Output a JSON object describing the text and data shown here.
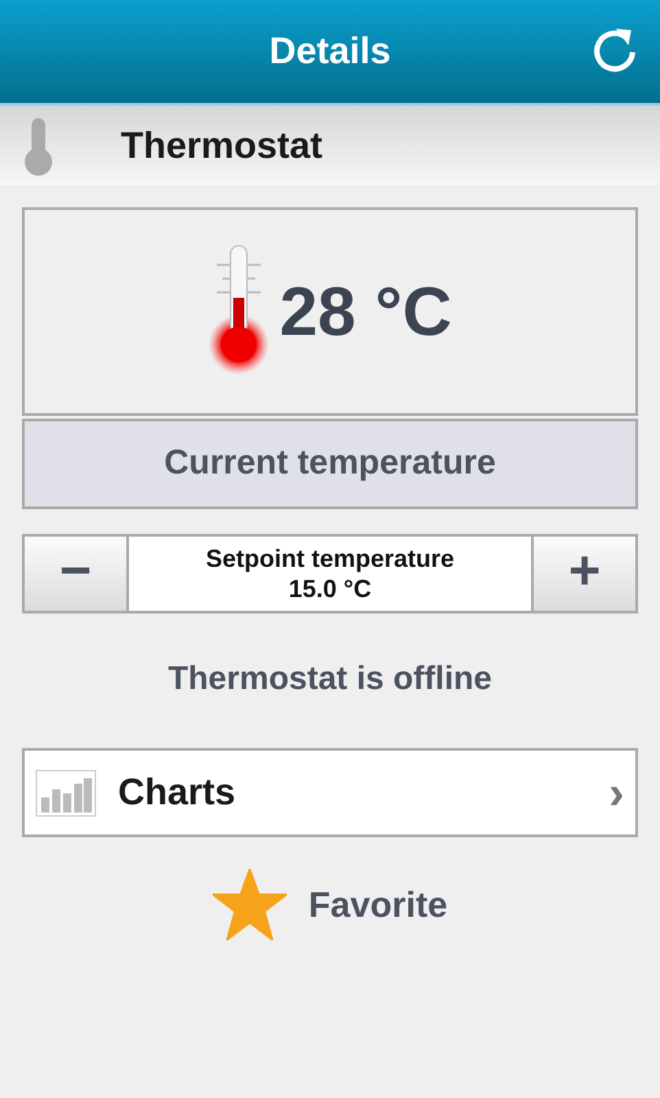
{
  "header": {
    "title": "Details"
  },
  "device": {
    "name": "Thermostat"
  },
  "current": {
    "value": "28 °C",
    "label": "Current temperature"
  },
  "setpoint": {
    "minus": "−",
    "label": "Setpoint temperature",
    "value": "15.0 °C",
    "plus": "+"
  },
  "status": "Thermostat is offline",
  "charts": {
    "label": "Charts",
    "chevron": "›"
  },
  "favorite": {
    "label": "Favorite",
    "selected": true
  }
}
